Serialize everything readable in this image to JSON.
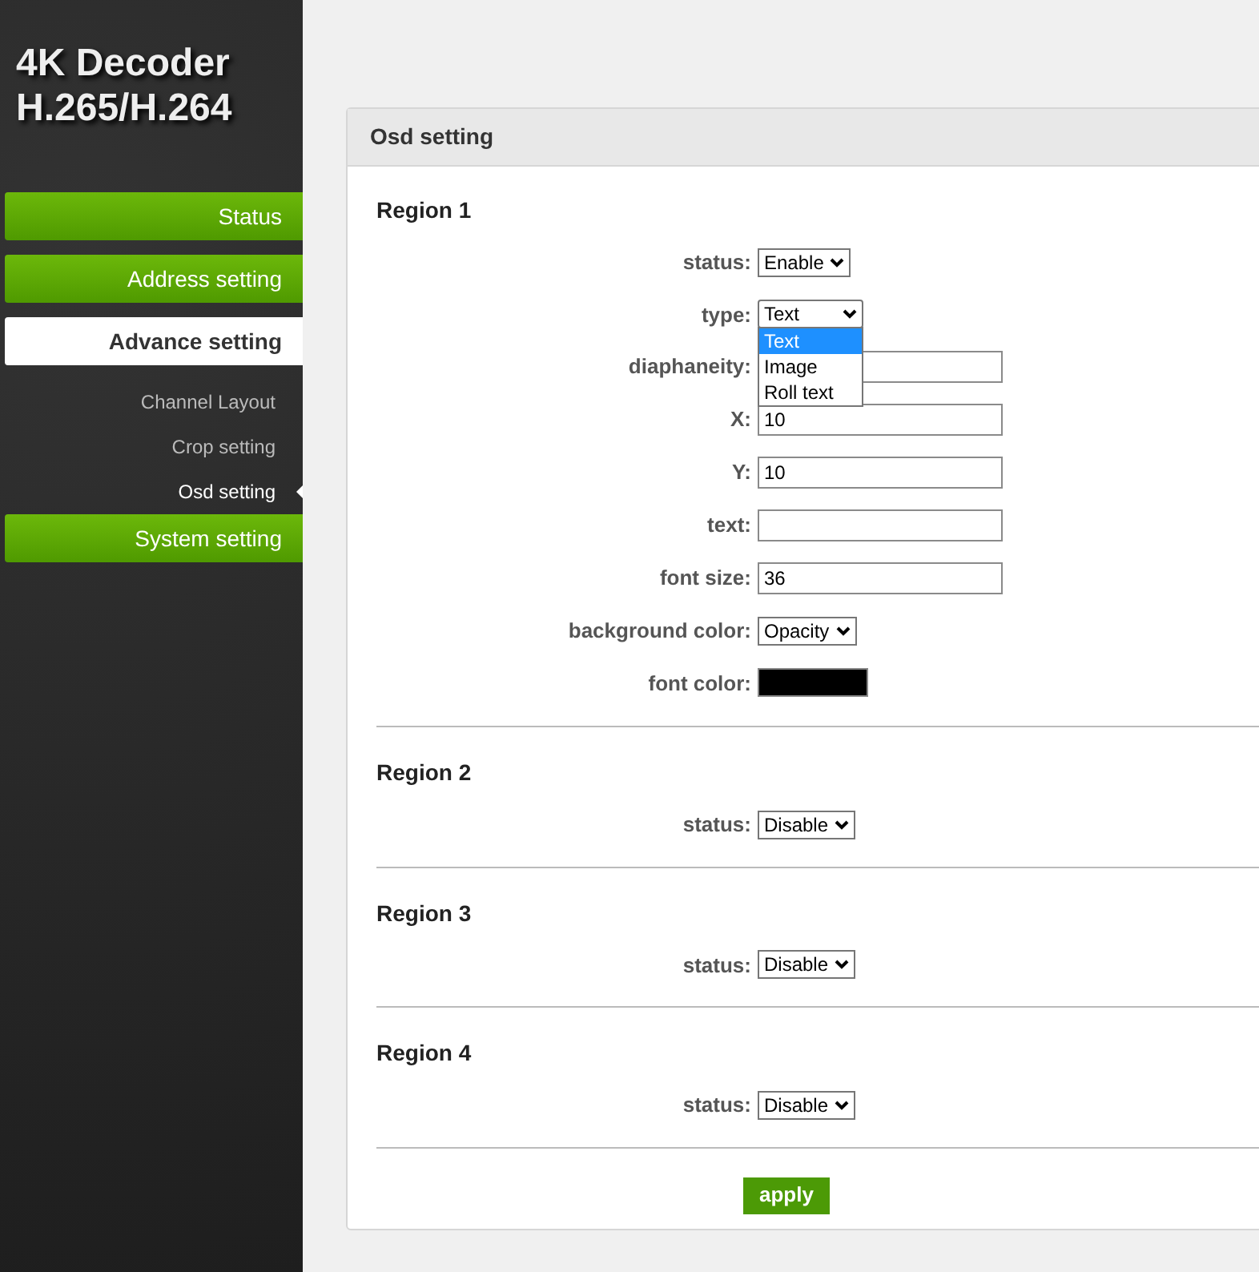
{
  "logo": {
    "lines": [
      "4K Decoder",
      "H.265/H.264"
    ]
  },
  "nav": [
    {
      "label": "Status",
      "kind": "main",
      "selected": false
    },
    {
      "label": "Address setting",
      "kind": "main",
      "selected": false
    },
    {
      "label": "Advance setting",
      "kind": "main",
      "selected": true
    },
    {
      "label": "Channel Layout",
      "kind": "sub",
      "selected": false
    },
    {
      "label": "Crop setting",
      "kind": "sub",
      "selected": false
    },
    {
      "label": "Osd setting",
      "kind": "sub",
      "selected": true
    },
    {
      "label": "System setting",
      "kind": "main",
      "selected": false
    }
  ],
  "panel": {
    "title": "Osd setting",
    "regions": [
      {
        "title": "Region 1",
        "fields": [
          {
            "label": "status:",
            "kind": "select",
            "value": "Enable"
          },
          {
            "label": "type:",
            "kind": "select",
            "value": "Text",
            "expanded": true,
            "options": [
              {
                "label": "Text",
                "selected": true
              },
              {
                "label": "Image",
                "selected": false
              },
              {
                "label": "Roll text",
                "selected": false
              }
            ]
          },
          {
            "label": "diaphaneity:",
            "kind": "input"
          },
          {
            "label": "X:",
            "kind": "input",
            "value": "10"
          },
          {
            "label": "Y:",
            "kind": "input",
            "value": "10"
          },
          {
            "label": "text:",
            "kind": "input"
          },
          {
            "label": "font size:",
            "kind": "input",
            "value": "36"
          },
          {
            "label": "background color:",
            "kind": "select",
            "value": "Opacity"
          },
          {
            "label": "font color:",
            "kind": "color",
            "color": "#000000"
          }
        ]
      },
      {
        "title": "Region 2",
        "fields": [
          {
            "label": "status:",
            "kind": "select",
            "value": "Disable"
          }
        ]
      },
      {
        "title": "Region 3",
        "fields": [
          {
            "label": "status:",
            "kind": "select",
            "value": "Disable"
          }
        ]
      },
      {
        "title": "Region 4",
        "fields": [
          {
            "label": "status:",
            "kind": "select",
            "value": "Disable"
          }
        ]
      }
    ],
    "apply": "apply"
  }
}
